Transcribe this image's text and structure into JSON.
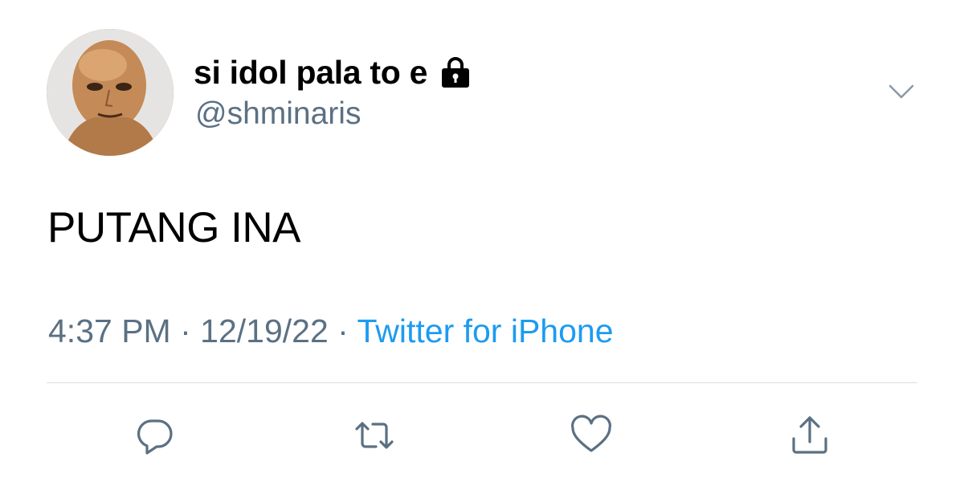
{
  "author": {
    "display_name": "si idol pala to e",
    "handle": "@shminaris",
    "protected_icon": "lock-icon",
    "avatar": "profile-avatar"
  },
  "tweet": {
    "text": "PUTANG INA",
    "time": "4:37 PM",
    "separator": "·",
    "date": "12/19/22",
    "source": "Twitter for iPhone"
  },
  "menu_icon": "chevron-down-icon",
  "actions": {
    "reply_icon": "reply-icon",
    "retweet_icon": "retweet-icon",
    "like_icon": "heart-icon",
    "share_icon": "share-icon"
  },
  "colors": {
    "text": "#000000",
    "secondary": "#5b7083",
    "link": "#1d9bf0",
    "divider": "#d8dee3"
  }
}
